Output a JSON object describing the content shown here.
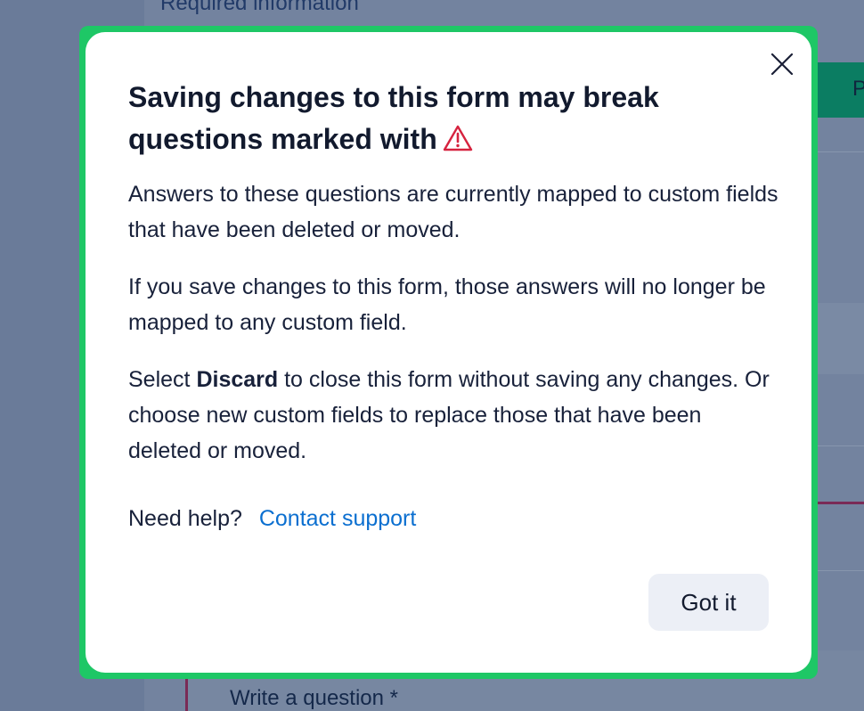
{
  "background": {
    "section_label": "Required information",
    "primary_button_label": "P",
    "question_placeholder": "Write a question *"
  },
  "modal": {
    "close_icon": "close-icon",
    "title": "Saving changes to this form may break questions marked with",
    "title_icon": "warning-triangle-icon",
    "paragraph_1": "Answers to these questions are currently mapped to custom fields that have been deleted or moved.",
    "paragraph_2": "If you save changes to this form, those answers will no longer be mapped to any custom field.",
    "paragraph_3_before": "Select ",
    "paragraph_3_bold": "Discard",
    "paragraph_3_after": " to close this form without saving any changes. Or choose new custom fields to replace those that have been deleted or moved.",
    "help_prompt": "Need help?",
    "help_link": "Contact support",
    "confirm_button": "Got it"
  },
  "colors": {
    "focus_ring": "#1ec766",
    "warning_icon": "#d6233f",
    "link": "#0b6fd0",
    "confirm_button_bg": "#eceff6"
  }
}
